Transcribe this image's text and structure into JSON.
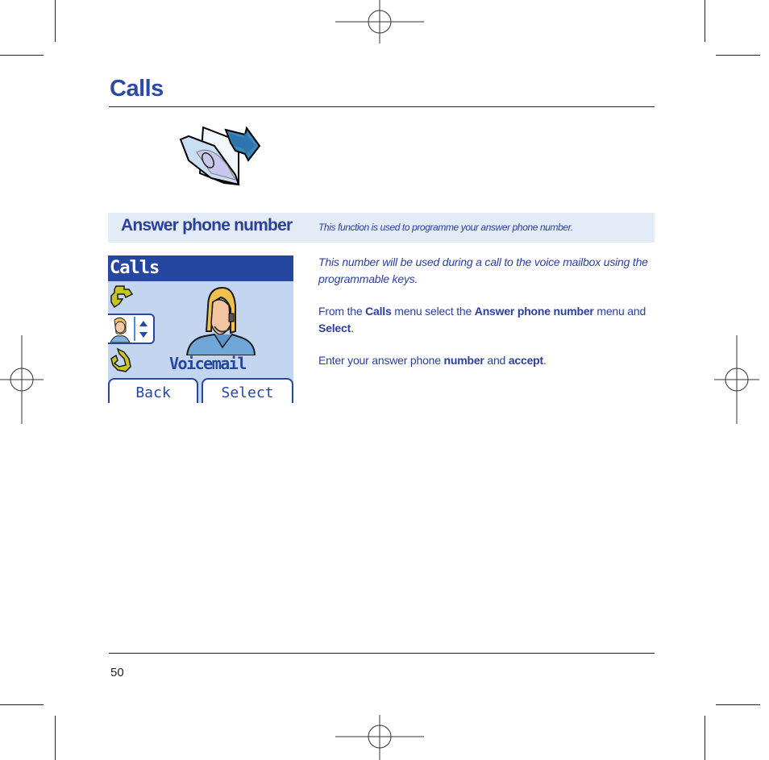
{
  "page": {
    "title": "Calls",
    "page_number": "50"
  },
  "section": {
    "heading": "Answer phone number",
    "description": "This function is used to programme your answer phone number."
  },
  "phone_screen": {
    "title": "Calls",
    "selected_item": "Voicemail",
    "softkeys": {
      "left": "Back",
      "right": "Select"
    },
    "colors": {
      "header": "#2647a0",
      "background": "#c4d6ef"
    }
  },
  "body": {
    "intro": "This number will be used during a call to the voice mailbox using the programmable keys.",
    "step1": {
      "prefix": "From the ",
      "menu": "Calls",
      "middle": " menu select the ",
      "item": "Answer phone number",
      "middle2": " menu and ",
      "action": "Select",
      "suffix": "."
    },
    "step2": {
      "prefix": "Enter your answer phone ",
      "field": "number",
      "middle": " and ",
      "action": "accept",
      "suffix": "."
    }
  },
  "icons": {
    "header_icon": "calls-folder-icon",
    "phone_icons": [
      "call-forward-icon",
      "voicemail-operator-icon",
      "scroll-arrows-icon",
      "call-redirect-icon",
      "operator-headset-icon"
    ]
  },
  "colors": {
    "accent": "#2b4aa5",
    "section_bar": "#e3ebf7"
  }
}
